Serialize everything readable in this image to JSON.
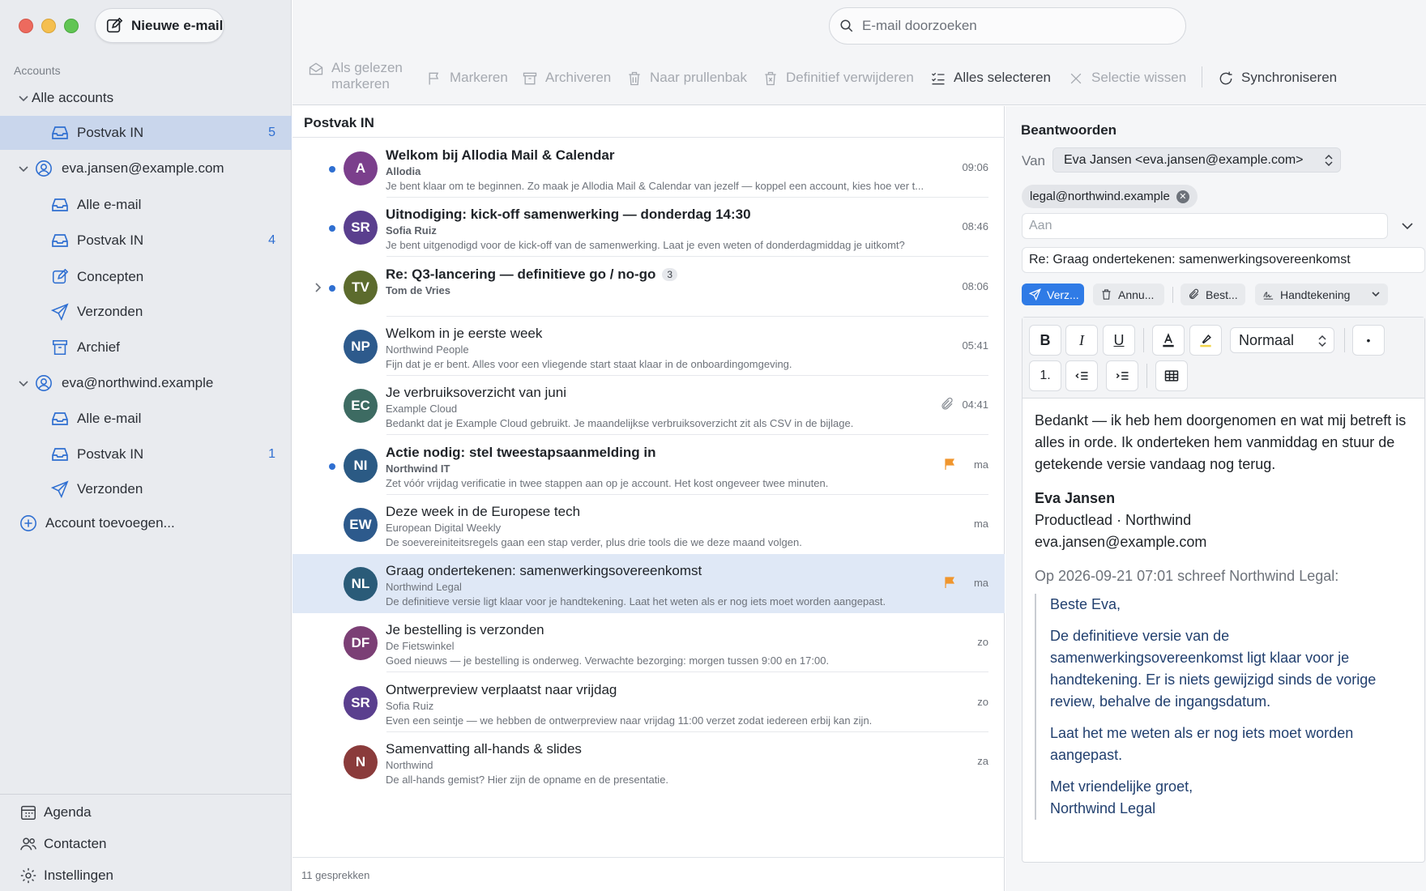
{
  "toolbar": {
    "new_mail_label": "Nieuwe e-mail",
    "search_placeholder": "E-mail doorzoeken",
    "mark_read_line1": "Als gelezen",
    "mark_read_line2": "markeren",
    "flag": "Markeren",
    "archive": "Archiveren",
    "trash": "Naar prullenbak",
    "delete": "Definitief verwijderen",
    "select_all": "Alles selecteren",
    "clear_selection": "Selectie wissen",
    "sync": "Synchroniseren"
  },
  "sidebar": {
    "heading": "Accounts",
    "all_accounts": "Alle accounts",
    "unified_inbox": {
      "label": "Postvak IN",
      "count": "5"
    },
    "account1": {
      "email": "eva.jansen@example.com",
      "all_mail": "Alle e-mail",
      "inbox": {
        "label": "Postvak IN",
        "count": "4"
      },
      "drafts": "Concepten",
      "sent": "Verzonden",
      "archive": "Archief"
    },
    "account2": {
      "email": "eva@northwind.example",
      "all_mail": "Alle e-mail",
      "inbox": {
        "label": "Postvak IN",
        "count": "1"
      },
      "sent": "Verzonden"
    },
    "add_account": "Account toevoegen...",
    "calendar": "Agenda",
    "contacts": "Contacten",
    "settings": "Instellingen"
  },
  "list": {
    "title": "Postvak IN",
    "footer": "11 gesprekken",
    "items": [
      {
        "initials": "A",
        "color": "#7b3f8c",
        "subject": "Welkom bij Allodia Mail & Calendar",
        "sender": "Allodia",
        "preview": "Je bent klaar om te beginnen. Zo maak je Allodia Mail & Calendar van jezelf — koppel een account, kies hoe ver t...",
        "time": "09:06",
        "unread": true
      },
      {
        "initials": "SR",
        "color": "#5a3f8e",
        "subject": "Uitnodiging: kick-off samenwerking — donderdag 14:30",
        "sender": "Sofia Ruiz",
        "preview": "Je bent uitgenodigd voor de kick-off van de samenwerking. Laat je even weten of donderdagmiddag je uitkomt?",
        "time": "08:46",
        "unread": true
      },
      {
        "initials": "TV",
        "color": "#5c6b2d",
        "subject": "Re: Q3-lancering — definitieve go / no-go",
        "thread_count": "3",
        "sender": "Tom de Vries",
        "preview": "",
        "time": "08:06",
        "unread": true
      },
      {
        "initials": "NP",
        "color": "#2d5a8c",
        "subject": "Welkom in je eerste week",
        "sender": "Northwind People",
        "preview": "Fijn dat je er bent. Alles voor een vliegende start staat klaar in de onboardingomgeving.",
        "time": "05:41",
        "unread": false
      },
      {
        "initials": "EC",
        "color": "#3d6b62",
        "subject": "Je verbruiksoverzicht van juni",
        "sender": "Example Cloud",
        "preview": "Bedankt dat je Example Cloud gebruikt. Je maandelijkse verbruiksoverzicht zit als CSV in de bijlage.",
        "time": "04:41",
        "unread": false
      },
      {
        "initials": "NI",
        "color": "#2b5a84",
        "subject": "Actie nodig: stel tweestapsaanmelding in",
        "sender": "Northwind IT",
        "preview": "Zet vóór vrijdag verificatie in twee stappen aan op je account. Het kost ongeveer twee minuten.",
        "time": "ma",
        "unread": true
      },
      {
        "initials": "EW",
        "color": "#2d5a8c",
        "subject": "Deze week in de Europese tech",
        "sender": "European Digital Weekly",
        "preview": "De soevereiniteitsregels gaan een stap verder, plus drie tools die we deze maand volgen.",
        "time": "ma",
        "unread": false
      },
      {
        "initials": "NL",
        "color": "#2a5b78",
        "subject": "Graag ondertekenen: samenwerkingsovereenkomst",
        "sender": "Northwind Legal",
        "preview": "De definitieve versie ligt klaar voor je handtekening. Laat het weten als er nog iets moet worden aangepast.",
        "time": "ma",
        "unread": false
      },
      {
        "initials": "DF",
        "color": "#7b3f75",
        "subject": "Je bestelling is verzonden",
        "sender": "De Fietswinkel",
        "preview": "Goed nieuws — je bestelling is onderweg. Verwachte bezorging: morgen tussen 9:00 en 17:00.",
        "time": "zo",
        "unread": false
      },
      {
        "initials": "SR",
        "color": "#5a3f8e",
        "subject": "Ontwerpreview verplaatst naar vrijdag",
        "sender": "Sofia Ruiz",
        "preview": "Even een seintje — we hebben de ontwerpreview naar vrijdag 11:00 verzet zodat iedereen erbij kan zijn.",
        "time": "zo",
        "unread": false
      },
      {
        "initials": "N",
        "color": "#8a3b3b",
        "subject": "Samenvatting all-hands & slides",
        "sender": "Northwind",
        "preview": "De all-hands gemist? Hier zijn de opname en de presentatie.",
        "time": "za",
        "unread": false
      }
    ]
  },
  "reply": {
    "title": "Beantwoorden",
    "from_label": "Van",
    "from_value": "Eva Jansen <eva.jansen@example.com>",
    "recipient_chip": "legal@northwind.example",
    "to_placeholder": "Aan",
    "subject": "Re: Graag ondertekenen: samenwerkingsovereenkomst",
    "send": "Verz...",
    "cancel": "Annu...",
    "attach": "Best...",
    "signature": "Handtekening",
    "format": {
      "bold": "B",
      "italic": "I",
      "underline": "U",
      "style": "Normaal",
      "numbered": "1.",
      "bullet": "•"
    },
    "body": {
      "para1": "Bedankt — ik heb hem doorgenomen en wat mij betreft is alles in orde. Ik onderteken hem vanmiddag en stuur de getekende versie vandaag nog terug.",
      "sig_name": "Eva Jansen",
      "sig_role": "Productlead · Northwind",
      "sig_email": "eva.jansen@example.com",
      "quote_header": "Op 2026-09-21 07:01 schreef Northwind Legal:",
      "quote_greeting": "Beste Eva,",
      "quote_para1": "De definitieve versie van de samenwerkingsovereenkomst ligt klaar voor je handtekening. Er is niets gewijzigd sinds de vorige review, behalve de ingangsdatum.",
      "quote_para2": "Laat het me weten als er nog iets moet worden aangepast.",
      "quote_closing1": "Met vriendelijke groet,",
      "quote_closing2": "Northwind Legal"
    }
  },
  "colors": {
    "accent": "#2f7be6",
    "selected_row": "#dfe8f6",
    "unread_dot": "#2f6fd1",
    "flag": "#f0962e"
  }
}
